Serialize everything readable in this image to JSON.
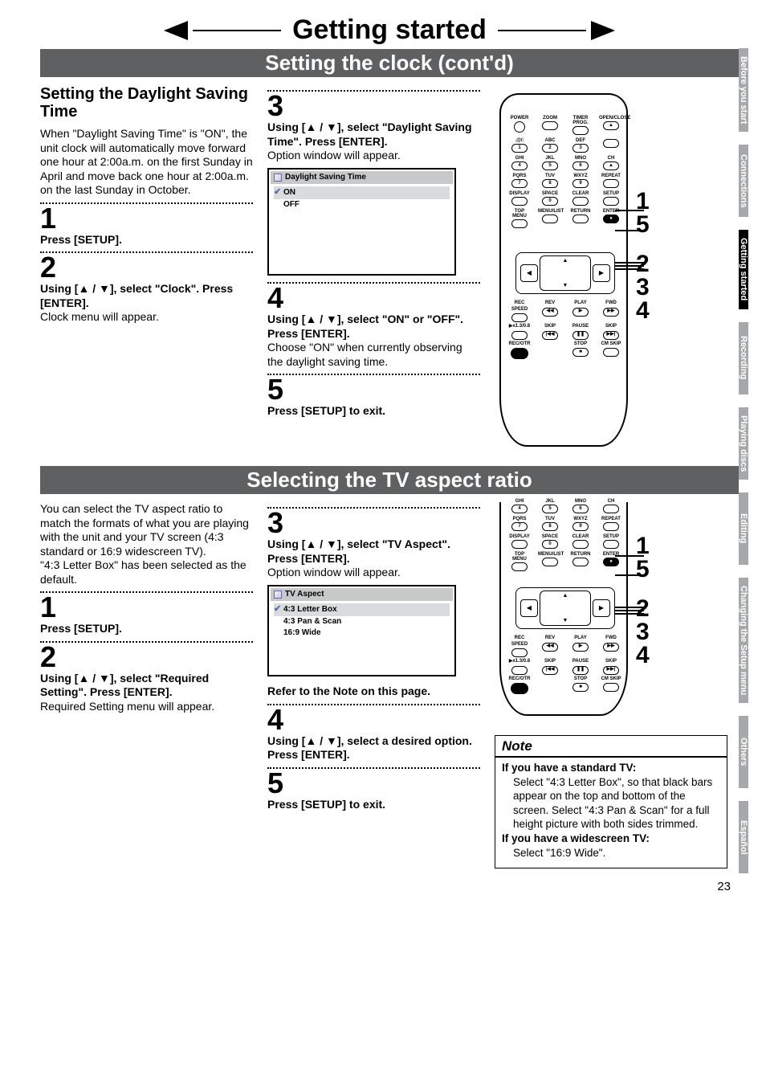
{
  "page_title": "Getting started",
  "bar1": "Setting the clock (cont'd)",
  "bar2": "Selecting the TV aspect ratio",
  "page_number": "23",
  "tabs": {
    "t1": "Before you start",
    "t2": "Connections",
    "t3": "Getting started",
    "t4": "Recording",
    "t5": "Playing discs",
    "t6": "Editing",
    "t7": "Changing the Setup menu",
    "t8": "Others",
    "t9": "Español"
  },
  "dst": {
    "heading": "Setting the Daylight Saving Time",
    "intro": "When \"Daylight Saving Time\" is \"ON\", the unit clock will automatically move forward one hour at 2:00a.m. on the first Sunday in April and move back one hour at 2:00a.m. on the last Sunday in October.",
    "s1n": "1",
    "s1": "Press [SETUP].",
    "s2n": "2",
    "s2": "Using [▲ / ▼], select \"Clock\". Press [ENTER].",
    "s2sub": "Clock menu will appear.",
    "s3n": "3",
    "s3": "Using [▲ / ▼], select \"Daylight Saving Time\". Press [ENTER].",
    "s3sub": "Option window will appear.",
    "box_head": "Daylight Saving Time",
    "box_on": "ON",
    "box_off": "OFF",
    "s4n": "4",
    "s4": "Using [▲ / ▼], select \"ON\" or \"OFF\". Press [ENTER].",
    "s4sub": "Choose \"ON\" when currently observing the daylight saving time.",
    "s5n": "5",
    "s5": "Press [SETUP] to exit."
  },
  "aspect": {
    "intro": "You can select the TV aspect ratio to match the formats of what you are playing with the unit and your TV screen (4:3 standard or 16:9 widescreen TV).\n\"4:3 Letter Box\" has been selected as the default.",
    "s1n": "1",
    "s1": "Press [SETUP].",
    "s2n": "2",
    "s2": "Using [▲ / ▼], select \"Required Setting\". Press [ENTER].",
    "s2sub": "Required Setting menu will appear.",
    "s3n": "3",
    "s3": "Using [▲ / ▼], select \"TV Aspect\". Press [ENTER].",
    "s3sub": "Option window will appear.",
    "box_head": "TV Aspect",
    "box_o1": "4:3 Letter Box",
    "box_o2": "4:3 Pan & Scan",
    "box_o3": "16:9 Wide",
    "refer": "Refer to the Note on this page.",
    "s4n": "4",
    "s4": "Using [▲ / ▼], select a desired option. Press [ENTER].",
    "s5n": "5",
    "s5": "Press [SETUP] to exit."
  },
  "note": {
    "head": "Note",
    "h1": "If you have a standard TV:",
    "b1": "Select \"4:3 Letter Box\", so that black bars appear on the top and bottom of the screen. Select \"4:3 Pan & Scan\" for a full height picture with both sides trimmed.",
    "h2": "If you have a widescreen TV:",
    "b2": "Select \"16:9 Wide\"."
  },
  "remote": {
    "labels": [
      "POWER",
      "ZOOM",
      "TIMER PROG.",
      "OPEN/CLOSE",
      ".@/:",
      "ABC",
      "DEF",
      "",
      "GHI",
      "JKL",
      "MNO",
      "CH",
      "PQRS",
      "TUV",
      "WXYZ",
      "REPEAT",
      "DISPLAY",
      "SPACE",
      "CLEAR",
      "SETUP",
      "TOP MENU",
      "MENU/LIST",
      "RETURN",
      "ENTER",
      "REC SPEED",
      "REV",
      "PLAY",
      "FWD",
      "▶x1.3/0.8",
      "SKIP",
      "PAUSE",
      "SKIP",
      "REC/OTR",
      "",
      "STOP",
      "CM SKIP"
    ],
    "nums": [
      "",
      "",
      "",
      "",
      "1",
      "2",
      "3",
      "",
      "4",
      "5",
      "6",
      "",
      "7",
      "8",
      "9",
      "",
      "",
      "0",
      "",
      "",
      "",
      "",
      "",
      "",
      "",
      "",
      "",
      "",
      "",
      "",
      "",
      "",
      "",
      "",
      "",
      ""
    ],
    "callouts_top": [
      "1",
      "5"
    ],
    "callouts_bot": [
      "2",
      "3",
      "4"
    ]
  }
}
